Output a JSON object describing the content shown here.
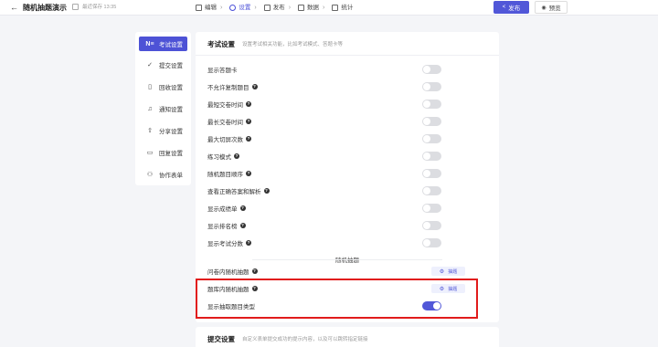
{
  "header": {
    "back_glyph": "←",
    "title": "随机抽题演示",
    "save_status": "最近保存 13:35",
    "steps": [
      {
        "label": "编辑",
        "icon": "edit-icon"
      },
      {
        "label": "设置",
        "icon": "gear-icon",
        "active": true
      },
      {
        "label": "发布",
        "icon": "send-icon"
      },
      {
        "label": "数据",
        "icon": "data-icon"
      },
      {
        "label": "统计",
        "icon": "stats-icon"
      }
    ],
    "publish_label": "发布",
    "preview_label": "预览"
  },
  "sidebar": {
    "items": [
      {
        "label": "考试设置",
        "glyph": "N≡",
        "icon": "exam-settings-icon",
        "active": true
      },
      {
        "label": "提交设置",
        "glyph": "✓",
        "icon": "submit-icon"
      },
      {
        "label": "回收设置",
        "glyph": "▯",
        "icon": "collect-icon"
      },
      {
        "label": "通知设置",
        "glyph": "♫",
        "icon": "bell-icon"
      },
      {
        "label": "分享设置",
        "glyph": "⇧",
        "icon": "share-icon"
      },
      {
        "label": "回复设置",
        "glyph": "▭",
        "icon": "reply-icon"
      },
      {
        "label": "协作表单",
        "glyph": "⚇",
        "icon": "collaborate-icon"
      }
    ]
  },
  "exam_settings": {
    "title": "考试设置",
    "subtitle": "设置考试相关功能，比如考试模式、答题卡等",
    "rows": [
      {
        "label": "显示答题卡",
        "help": false,
        "on": false
      },
      {
        "label": "不允许复制题目",
        "help": true,
        "on": false
      },
      {
        "label": "最短交卷时间",
        "help": true,
        "on": false
      },
      {
        "label": "最长交卷时间",
        "help": true,
        "on": false
      },
      {
        "label": "最大切屏次数",
        "help": true,
        "on": false
      },
      {
        "label": "练习模式",
        "help": true,
        "on": false
      },
      {
        "label": "随机题目顺序",
        "help": true,
        "on": false
      },
      {
        "label": "查看正确答案和解析",
        "help": true,
        "on": false
      },
      {
        "label": "显示成绩单",
        "help": true,
        "on": false
      },
      {
        "label": "显示排名榜",
        "help": true,
        "on": false
      },
      {
        "label": "显示考试分数",
        "help": true,
        "on": false
      }
    ],
    "random_section": "随机抽题",
    "random_rows": [
      {
        "label": "问卷内随机抽题",
        "help": true,
        "tag": "抽题"
      },
      {
        "label": "题库内随机抽题",
        "help": true,
        "tag": "抽题"
      },
      {
        "label": "显示抽取题目类型",
        "help": false,
        "on": true
      }
    ]
  },
  "submit_settings": {
    "title": "提交设置",
    "subtitle": "自定义表单提交成功的提示内容，以及可以跳转指定链接"
  },
  "colors": {
    "accent": "#5157d8",
    "highlight": "#e11b1b"
  }
}
